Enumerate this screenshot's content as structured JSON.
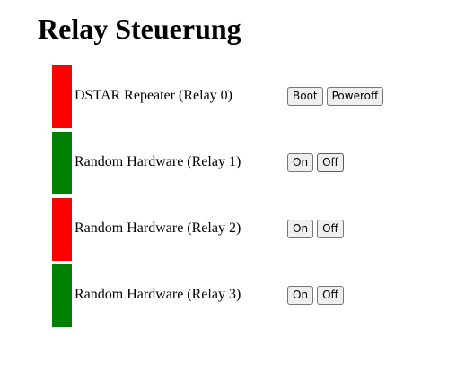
{
  "page": {
    "title": "Relay Steuerung"
  },
  "colors": {
    "on": "#008000",
    "off": "#ff0000"
  },
  "relays": [
    {
      "name": "DSTAR Repeater (Relay 0)",
      "state": "off",
      "status_color": "#ff0000",
      "buttons": [
        "Boot",
        "Poweroff"
      ]
    },
    {
      "name": "Random Hardware (Relay 1)",
      "state": "on",
      "status_color": "#008000",
      "buttons": [
        "On",
        "Off"
      ]
    },
    {
      "name": "Random Hardware (Relay 2)",
      "state": "off",
      "status_color": "#ff0000",
      "buttons": [
        "On",
        "Off"
      ]
    },
    {
      "name": "Random Hardware (Relay 3)",
      "state": "on",
      "status_color": "#008000",
      "buttons": [
        "On",
        "Off"
      ]
    }
  ]
}
